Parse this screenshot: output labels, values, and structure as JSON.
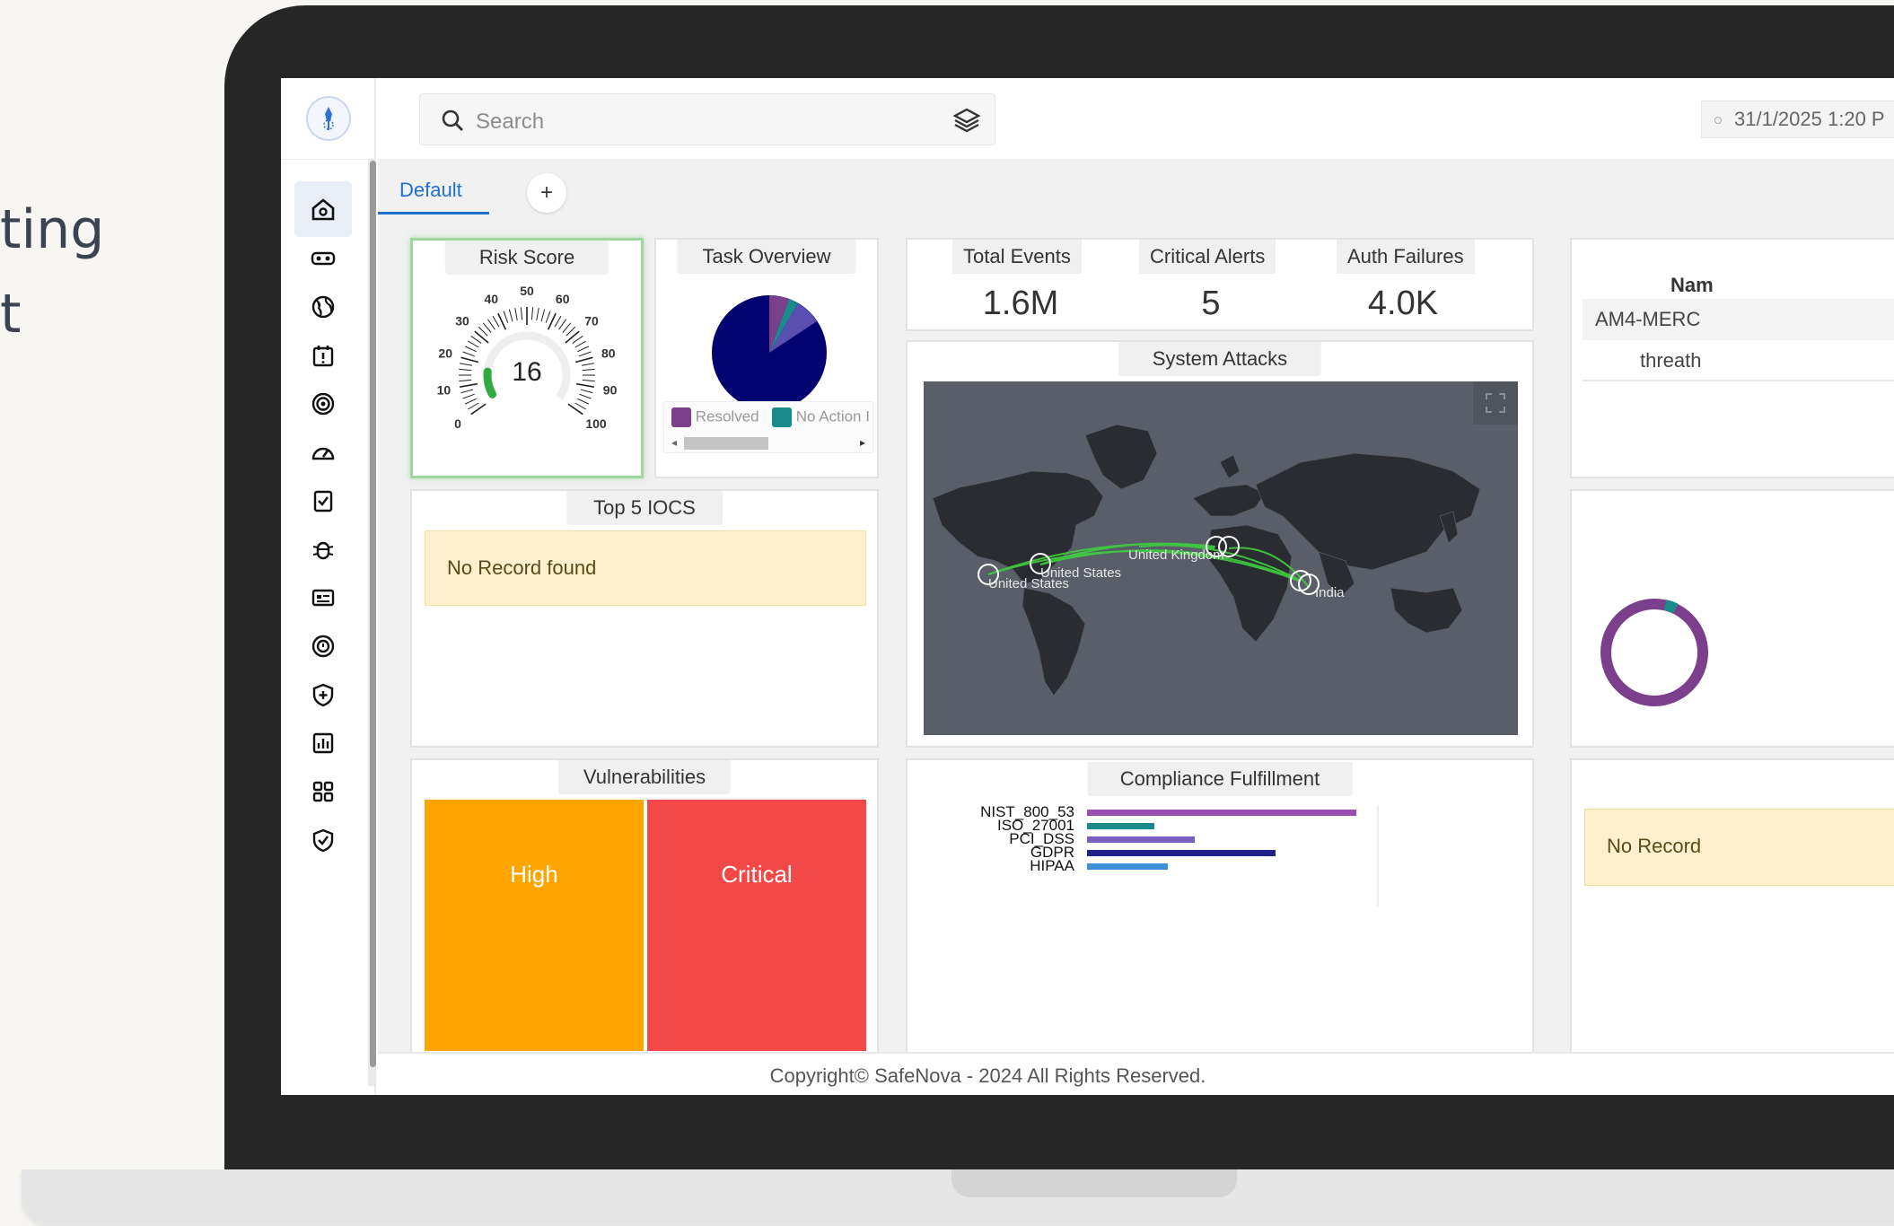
{
  "background_text": {
    "line1": "ting",
    "line2": "t"
  },
  "topbar": {
    "search_placeholder": "Search",
    "datetime": "31/1/2025 1:20 P"
  },
  "tabs": {
    "default_label": "Default",
    "add_label": "+"
  },
  "sidebar": {
    "icons": [
      "home-icon",
      "vr-goggles-icon",
      "globe-icon",
      "calendar-alert-icon",
      "target-icon",
      "gauge-icon",
      "clipboard-check-icon",
      "bug-icon",
      "id-card-icon",
      "clock-badge-icon",
      "shield-plus-icon",
      "bar-report-icon",
      "grid-apps-icon",
      "shield-check-icon"
    ]
  },
  "risk_score": {
    "title": "Risk Score",
    "value": "16",
    "level_fraction": 0.16,
    "ticks": [
      "0",
      "10",
      "20",
      "30",
      "40",
      "50",
      "60",
      "70",
      "80",
      "90",
      "100"
    ]
  },
  "task_overview": {
    "title": "Task Overview",
    "legend": [
      "Resolved",
      "No Action I"
    ],
    "colors": {
      "main": "#020270",
      "resolved": "#7b3f8c",
      "no_action": "#1a8a8a",
      "other": "#5a4fb0"
    }
  },
  "stats": {
    "total_events_label": "Total Events",
    "total_events_value": "1.6M",
    "critical_alerts_label": "Critical Alerts",
    "critical_alerts_value": "5",
    "auth_failures_label": "Auth Failures",
    "auth_failures_value": "4.0K"
  },
  "right_panel": {
    "name_header": "Nam",
    "row1": "AM4-MERC",
    "row2": "threath"
  },
  "system_attacks": {
    "title": "System Attacks",
    "labels": [
      "United Kingdom",
      "United States",
      "United States",
      "India"
    ]
  },
  "top_iocs": {
    "title": "Top 5 IOCS",
    "empty": "No Record found"
  },
  "vulnerabilities": {
    "title": "Vulnerabilities",
    "blocks": [
      {
        "label": "High",
        "color": "#ffa500"
      },
      {
        "label": "Critical",
        "color": "#f24848"
      }
    ]
  },
  "compliance": {
    "title": "Compliance Fulfillment",
    "chart_data": {
      "type": "bar",
      "categories": [
        "NIST_800_53",
        "ISO_27001",
        "PCI_DSS",
        "GDPR",
        "HIPAA"
      ],
      "values": [
        100,
        25,
        40,
        70,
        30
      ],
      "colors": [
        "#9a4fb0",
        "#1a8a8a",
        "#7a5fc0",
        "#20208a",
        "#3d8fd6"
      ],
      "xlim": [
        0,
        100
      ]
    }
  },
  "right_bottom": {
    "empty": "No Record"
  },
  "footer": {
    "text": "Copyright© SafeNova - 2024 All Rights Reserved."
  }
}
